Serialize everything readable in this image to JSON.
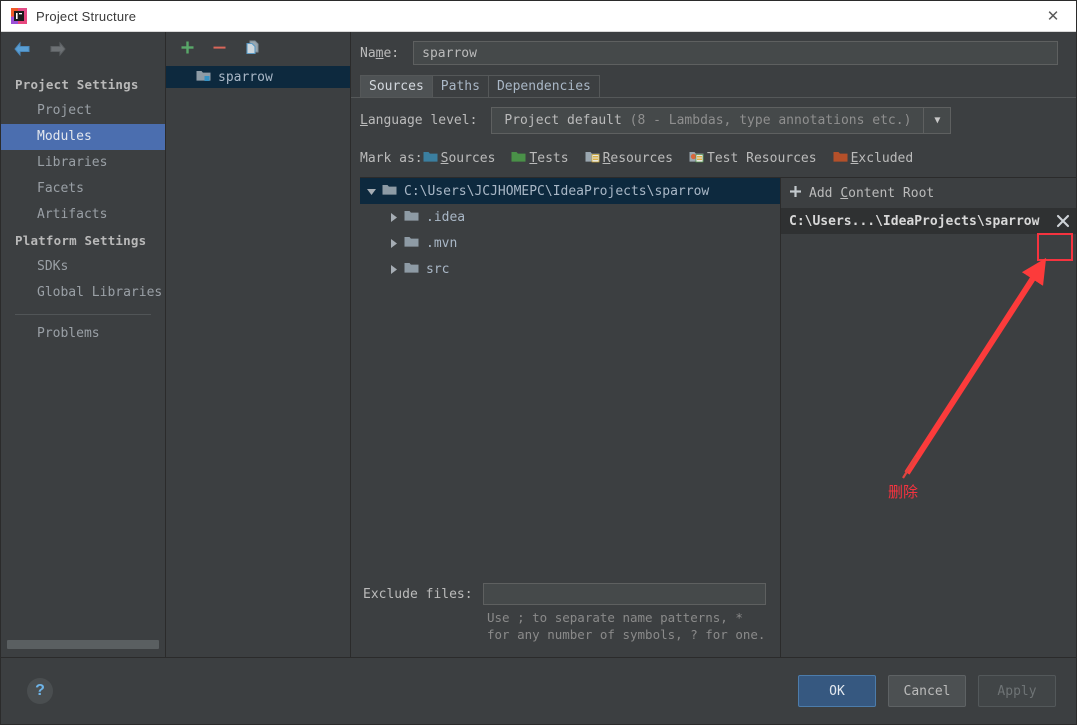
{
  "window": {
    "title": "Project Structure",
    "app_icon": "intellij-idea-icon",
    "close_label": "✕"
  },
  "sidebar": {
    "nav": {
      "back": "back-arrow",
      "forward": "forward-arrow"
    },
    "groups": [
      {
        "label": "Project Settings",
        "items": [
          {
            "label": "Project",
            "selected": false
          },
          {
            "label": "Modules",
            "selected": true
          },
          {
            "label": "Libraries",
            "selected": false
          },
          {
            "label": "Facets",
            "selected": false
          },
          {
            "label": "Artifacts",
            "selected": false
          }
        ]
      },
      {
        "label": "Platform Settings",
        "items": [
          {
            "label": "SDKs",
            "selected": false
          },
          {
            "label": "Global Libraries",
            "selected": false
          }
        ]
      }
    ],
    "extra_items": [
      {
        "label": "Problems",
        "selected": false
      }
    ]
  },
  "modules": {
    "toolbar": {
      "add": "plus-icon",
      "remove": "minus-icon",
      "copy": "copy-icon"
    },
    "list": [
      {
        "label": "sparrow",
        "selected": true,
        "icon": "module-folder-icon"
      }
    ]
  },
  "detail": {
    "name_label": "Name:",
    "name_mnemonic": "m",
    "name_value": "sparrow",
    "name_placeholder": "",
    "tabs": [
      {
        "label": "Sources",
        "active": true
      },
      {
        "label": "Paths",
        "active": false
      },
      {
        "label": "Dependencies",
        "active": false
      }
    ],
    "language": {
      "label_pre": "L",
      "label_post": "anguage level:",
      "value_main": "Project default ",
      "value_dim": "(8 - Lambdas, type annotations etc.)",
      "arrow": "chevron-down-icon"
    },
    "mark_as": {
      "label": "Mark as:",
      "options": [
        {
          "label": "Sources",
          "mn": "S",
          "rest": "ources",
          "icon": "sources-folder-icon",
          "color": "#3b7fa0"
        },
        {
          "label": "Tests",
          "mn": "T",
          "rest": "ests",
          "icon": "tests-folder-icon",
          "color": "#4a9148"
        },
        {
          "label": "Resources",
          "mn": "R",
          "rest": "esources",
          "icon": "resources-folder-icon",
          "color": "#9aa7b0"
        },
        {
          "label": "Test Resources",
          "mn": "",
          "rest": "Test Resources",
          "icon": "test-resources-folder-icon",
          "color": "#9aa7b0"
        },
        {
          "label": "Excluded",
          "mn": "E",
          "rest": "xcluded",
          "icon": "excluded-folder-icon",
          "color": "#b4502a"
        }
      ]
    },
    "tree": [
      {
        "label": "C:\\Users\\JCJHOMEPC\\IdeaProjects\\sparrow",
        "depth": 0,
        "expanded": true,
        "selected": true,
        "has_children": true
      },
      {
        "label": ".idea",
        "depth": 1,
        "expanded": false,
        "selected": false,
        "has_children": true
      },
      {
        "label": ".mvn",
        "depth": 1,
        "expanded": false,
        "selected": false,
        "has_children": true
      },
      {
        "label": "src",
        "depth": 1,
        "expanded": false,
        "selected": false,
        "has_children": true
      }
    ],
    "exclude": {
      "label": "Exclude files:",
      "value": "",
      "placeholder": "",
      "hint_line1": "Use ; to separate name patterns, *",
      "hint_line2": "for any number of symbols, ? for one."
    },
    "content_roots": {
      "add_label_pre": "Add ",
      "add_label_mn": "C",
      "add_label_post": "ontent Root",
      "add_icon": "plus-icon",
      "items": [
        {
          "path": "C:\\Users...\\IdeaProjects\\sparrow",
          "remove_icon": "close-x-icon"
        }
      ]
    }
  },
  "bottom": {
    "help": "?",
    "buttons": [
      {
        "label": "OK",
        "style": "primary"
      },
      {
        "label": "Cancel",
        "style": "normal"
      },
      {
        "label": "Apply",
        "style": "disabled"
      }
    ]
  },
  "annotation": {
    "text": "删除",
    "color": "#f5333f",
    "highlight_target": "content-root-remove-button"
  }
}
